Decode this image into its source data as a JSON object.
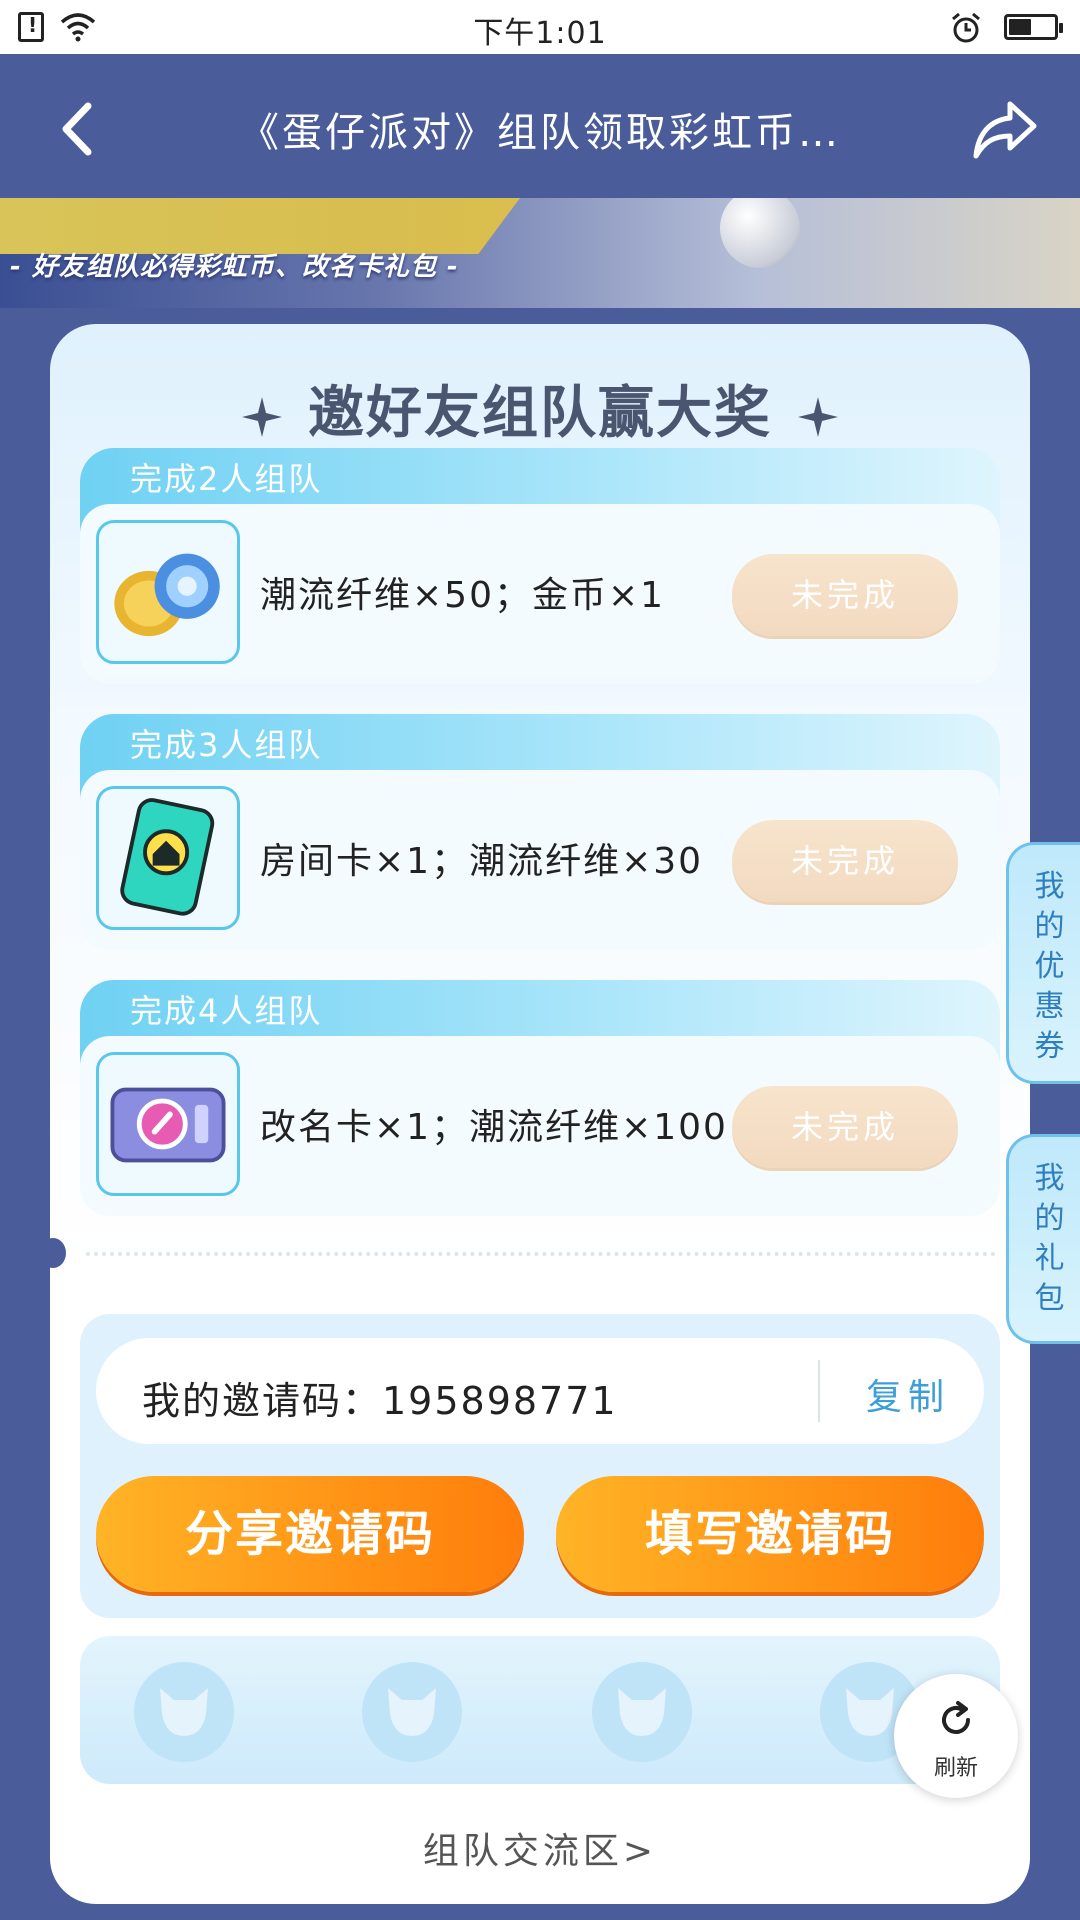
{
  "status_bar": {
    "time": "下午1:01",
    "battery_level": 0.5
  },
  "header": {
    "title": "《蛋仔派对》组队领取彩虹币…"
  },
  "banner": {
    "subtitle": "- 好友组队必得彩虹币、改名卡礼包 -"
  },
  "card": {
    "title": "邀好友组队赢大奖",
    "tasks": [
      {
        "title": "完成2人组队",
        "reward": "潮流纤维×50；金币×1",
        "button": "未完成",
        "icon": "coin-fiber-icon"
      },
      {
        "title": "完成3人组队",
        "reward": "房间卡×1；潮流纤维×30",
        "button": "未完成",
        "icon": "room-card-icon"
      },
      {
        "title": "完成4人组队",
        "reward": "改名卡×1；潮流纤维×100",
        "button": "未完成",
        "icon": "rename-card-icon"
      }
    ],
    "invite": {
      "code_label": "我的邀请码：195898771",
      "copy_label": "复制",
      "share_button": "分享邀请码",
      "fill_button": "填写邀请码"
    },
    "refresh_label": "刷新",
    "forum_link": "组队交流区>"
  },
  "side_tabs": {
    "coupons": "我的优惠券",
    "gifts": "我的礼包"
  },
  "colors": {
    "primary": "#4a5d9a",
    "accent_orange": "#ff8a10",
    "accent_blue": "#3d9fd8"
  }
}
